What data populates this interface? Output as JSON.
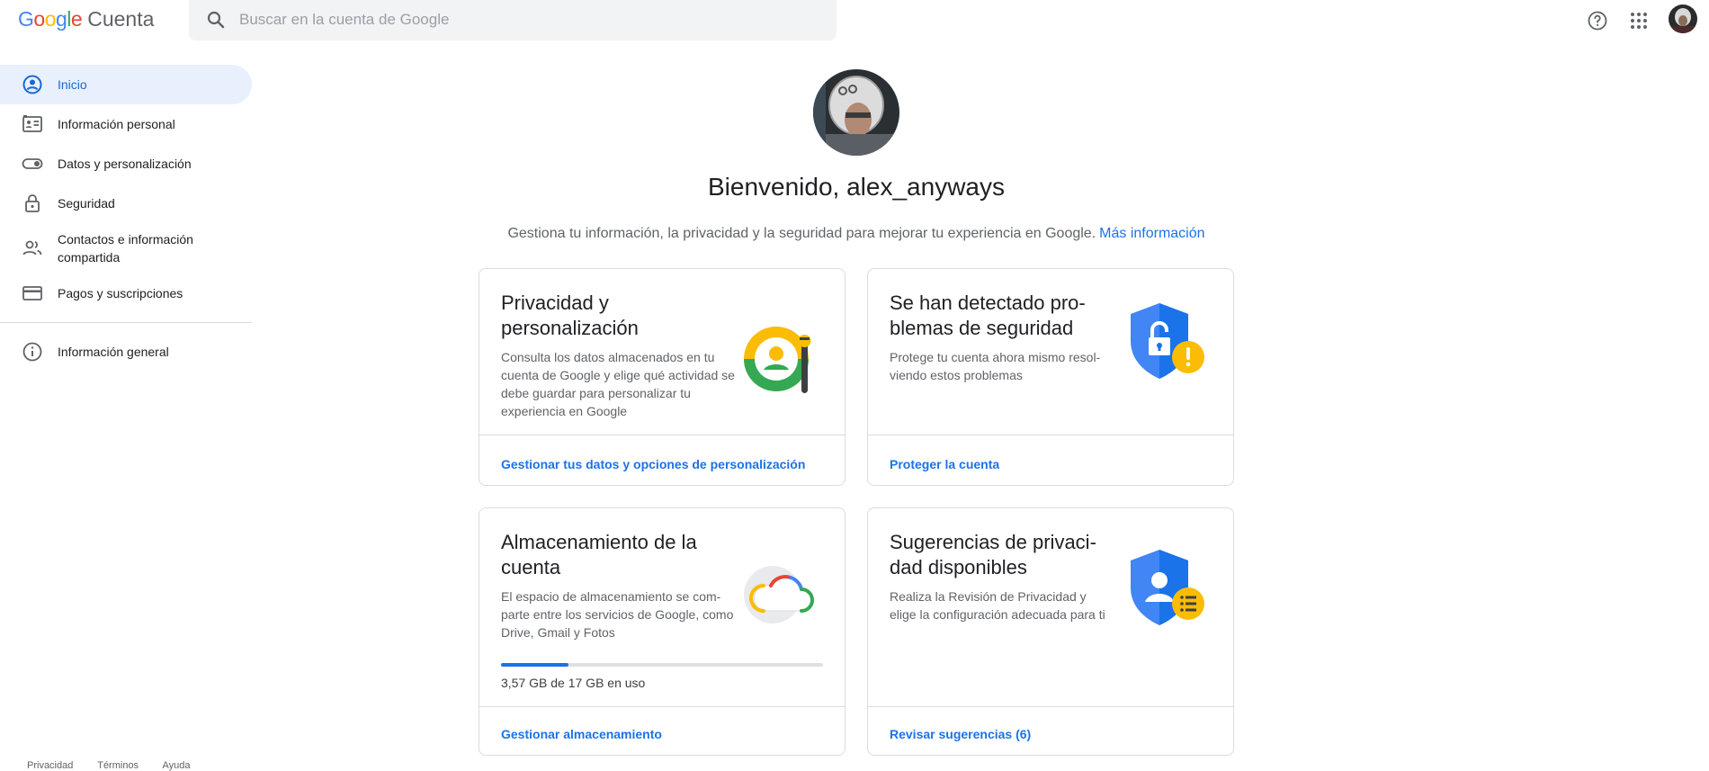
{
  "header": {
    "logo": {
      "letters": [
        "G",
        "o",
        "o",
        "g",
        "l",
        "e"
      ],
      "product": "Cuenta"
    },
    "search": {
      "placeholder": "Buscar en la cuenta de Google",
      "value": ""
    },
    "icons": [
      "help-icon",
      "apps-icon",
      "avatar"
    ]
  },
  "sidebar": {
    "items": [
      {
        "label": "Inicio",
        "icon": "home-icon",
        "active": true
      },
      {
        "label": "Información personal",
        "icon": "id-card-icon"
      },
      {
        "label": "Datos y personalización",
        "icon": "toggle-icon"
      },
      {
        "label": "Seguridad",
        "icon": "lock-icon"
      },
      {
        "label": "Contactos e información compartida",
        "icon": "people-icon"
      },
      {
        "label": "Pagos y suscripciones",
        "icon": "credit-card-icon"
      }
    ],
    "secondary": [
      {
        "label": "Información general",
        "icon": "info-icon"
      }
    ],
    "footer": [
      "Privacidad",
      "Términos",
      "Ayuda"
    ]
  },
  "main": {
    "welcome": "Bienvenido, alex_anyways",
    "subtitle": "Gestiona tu información, la privacidad y la seguridad para mejorar tu experiencia en Google.",
    "subtitle_link": "Más información",
    "cards": [
      {
        "title": "Privacidad y personalización",
        "desc": "Consulta los datos almacenados en tu cuenta de Google y elige qué actividad se debe guardar para personalizar tu experiencia en Google",
        "link": "Gestionar tus datos y opciones de personalización",
        "illustration": "privacy-illustration"
      },
      {
        "title": "Se han detectado pro- blemas de seguridad",
        "desc": "Protege tu cuenta ahora mismo resol- viendo estos problemas",
        "link": "Proteger la cuenta",
        "illustration": "security-shield-illustration"
      },
      {
        "title": "Almacenamiento de la cuenta",
        "desc": "El espacio de almacenamiento se com- parte entre los servicios de Google, como Drive, Gmail y Fotos",
        "usage": "3,57 GB de 17 GB en uso",
        "usage_fraction": 0.21,
        "link": "Gestionar almacenamiento",
        "illustration": "cloud-illustration"
      },
      {
        "title": "Sugerencias de privaci- dad disponibles",
        "desc": "Realiza la Revisión de Privacidad y elige la configuración adecuada para ti",
        "link": "Revisar sugerencias (6)",
        "illustration": "privacy-checkup-shield-illustration"
      }
    ]
  },
  "colors": {
    "accent": "#1a73e8",
    "active_bg": "#e8f0fe",
    "shield_blue": "#4285f4",
    "warning_yellow": "#fbbc05"
  }
}
